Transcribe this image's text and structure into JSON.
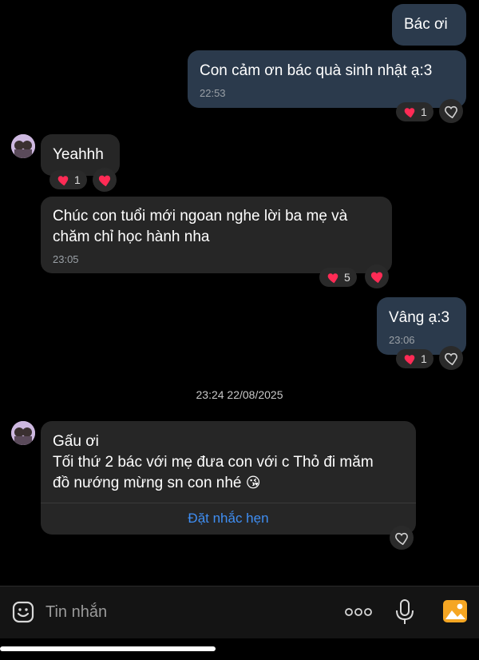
{
  "messages": [
    {
      "id": "m1",
      "direction": "out",
      "text": "Bác ơi"
    },
    {
      "id": "m2",
      "direction": "out",
      "text": "Con cảm ơn bác quà sinh nhật ạ:3",
      "time": "22:53",
      "reaction_count": "1"
    },
    {
      "id": "m3",
      "direction": "in",
      "text": "Yeahhh",
      "reaction_count": "1"
    },
    {
      "id": "m4",
      "direction": "in",
      "line1": "Chúc con tuổi mới ngoan nghe lời ba mẹ và",
      "line2": "chăm chỉ học hành nha",
      "time": "23:05",
      "reaction_count": "5"
    },
    {
      "id": "m5",
      "direction": "out",
      "text": "Vâng ạ:3",
      "time": "23:06",
      "reaction_count": "1"
    },
    {
      "id": "m6",
      "direction": "in",
      "line1": "Gấu ơi",
      "line2": "Tối thứ 2 bác với mẹ đưa con với c Thỏ đi măm",
      "line3": "đồ nướng mừng sn con nhé",
      "emoji": "😘",
      "action": "Đặt nhắc hẹn"
    }
  ],
  "date_separator": "23:24 22/08/2025",
  "composer": {
    "placeholder": "Tin nhắn",
    "icons": [
      "sticker-icon",
      "more-icon",
      "microphone-icon",
      "image-icon"
    ]
  },
  "colors": {
    "background": "#000000",
    "outgoing_bubble": "#2b3a4c",
    "incoming_bubble": "#262626",
    "heart": "#ff2b55",
    "link": "#3f8ef3",
    "image_button": "#f5a623"
  }
}
